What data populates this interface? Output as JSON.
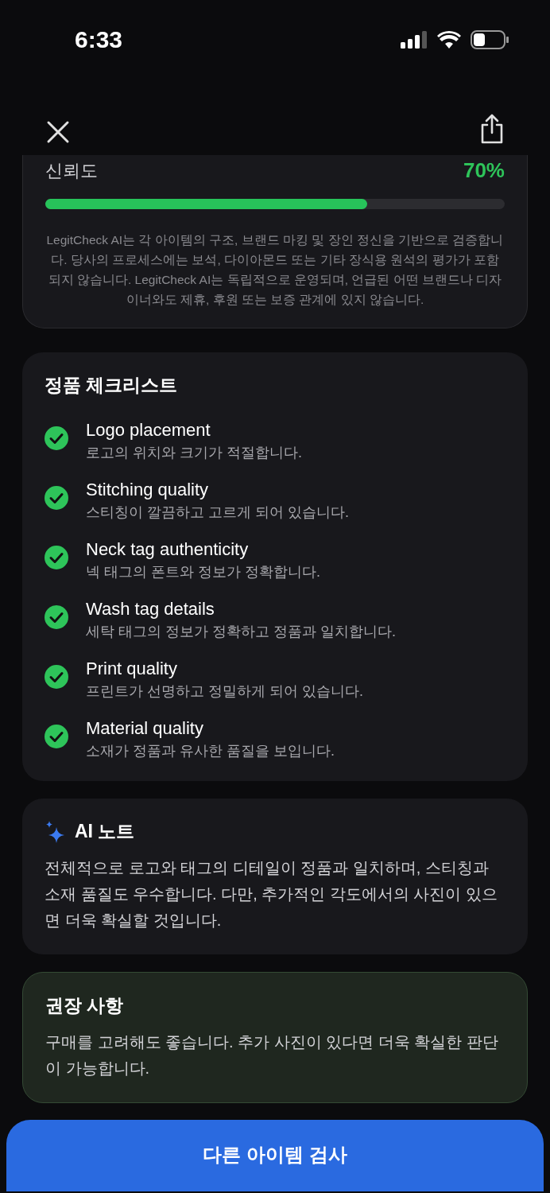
{
  "status_bar": {
    "time": "6:33"
  },
  "confidence": {
    "label": "신뢰도",
    "value": "70%",
    "level": 0.7,
    "disclaimer": "LegitCheck AI는 각 아이템의 구조, 브랜드 마킹 및 장인 정신을 기반으로 검증합니다. 당사의 프로세스에는 보석, 다이아몬드 또는 기타 장식용 원석의 평가가 포함되지 않습니다. LegitCheck AI는 독립적으로 운영되며, 언급된 어떤 브랜드나 디자이너와도 제휴, 후원 또는 보증 관계에 있지 않습니다."
  },
  "checklist": {
    "title": "정품 체크리스트",
    "items": [
      {
        "title": "Logo placement",
        "description": "로고의 위치와 크기가 적절합니다.",
        "checked": true
      },
      {
        "title": "Stitching quality",
        "description": "스티칭이 깔끔하고 고르게 되어 있습니다.",
        "checked": true
      },
      {
        "title": "Neck tag authenticity",
        "description": "넥 태그의 폰트와 정보가 정확합니다.",
        "checked": true
      },
      {
        "title": "Wash tag details",
        "description": "세탁 태그의 정보가 정확하고 정품과 일치합니다.",
        "checked": true
      },
      {
        "title": "Print quality",
        "description": "프린트가 선명하고 정밀하게 되어 있습니다.",
        "checked": true
      },
      {
        "title": "Material quality",
        "description": "소재가 정품과 유사한 품질을 보입니다.",
        "checked": true
      }
    ]
  },
  "ai_note": {
    "title": "AI 노트",
    "body": "전체적으로 로고와 태그의 디테일이 정품과 일치하며, 스티칭과 소재 품질도 우수합니다. 다만, 추가적인 각도에서의 사진이 있으면 더욱 확실할 것입니다."
  },
  "recommendation": {
    "title": "권장 사항",
    "body": "구매를 고려해도 좋습니다. 추가 사진이 있다면 더욱 확실한 판단이 가능합니다."
  },
  "action_button": {
    "label": "다른 아이템 검사"
  }
}
